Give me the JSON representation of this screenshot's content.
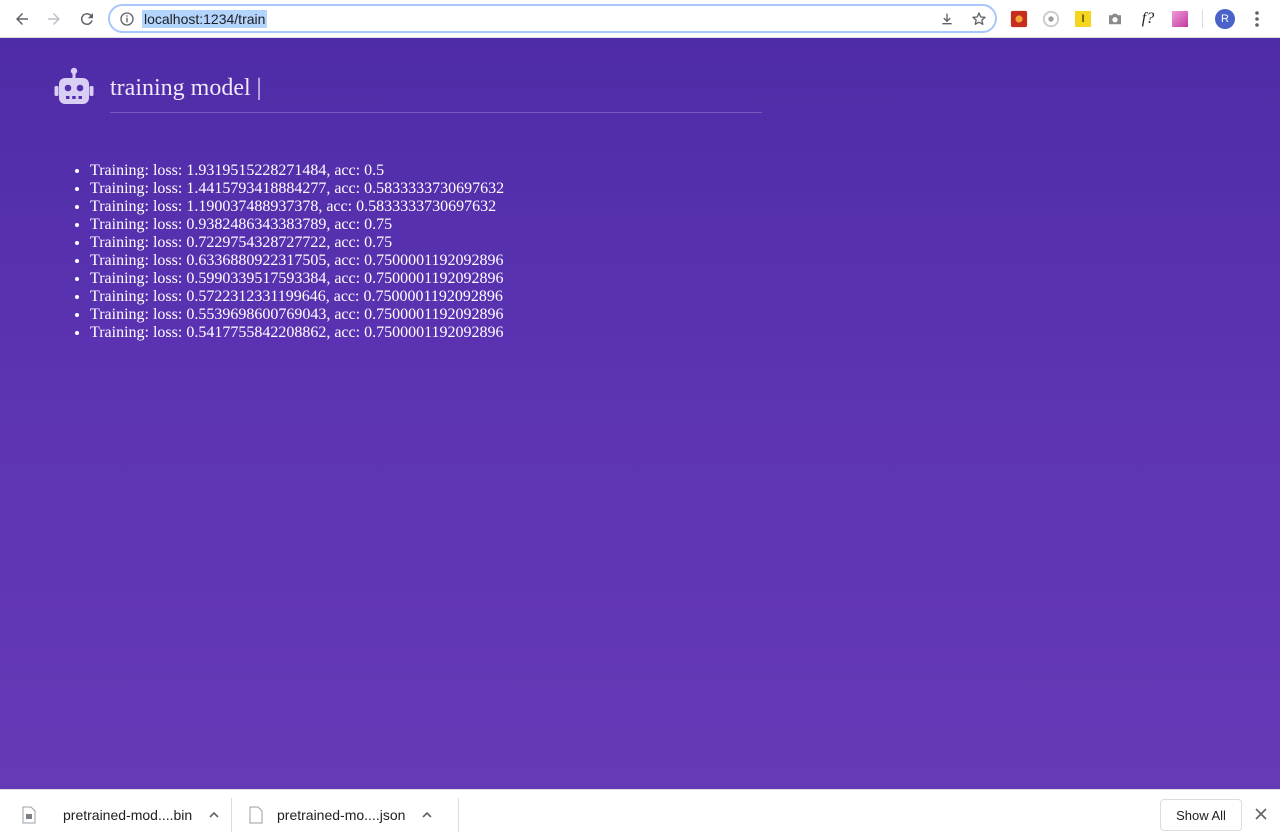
{
  "browser": {
    "url": "localhost:1234/train",
    "profile_initial": "R",
    "extensions": [
      "ext-red-icon",
      "ext-circle-icon",
      "ext-yellow-icon",
      "camera-icon",
      "font-f-icon",
      "gradient-icon"
    ],
    "font_ext_label": "f?",
    "yellow_ext_label": "I"
  },
  "page": {
    "title": "training model |",
    "log": [
      "Training: loss: 1.9319515228271484, acc: 0.5",
      "Training: loss: 1.4415793418884277, acc: 0.5833333730697632",
      "Training: loss: 1.190037488937378, acc: 0.5833333730697632",
      "Training: loss: 0.9382486343383789, acc: 0.75",
      "Training: loss: 0.7229754328727722, acc: 0.75",
      "Training: loss: 0.6336880922317505, acc: 0.7500001192092896",
      "Training: loss: 0.5990339517593384, acc: 0.7500001192092896",
      "Training: loss: 0.5722312331199646, acc: 0.7500001192092896",
      "Training: loss: 0.5539698600769043, acc: 0.7500001192092896",
      "Training: loss: 0.5417755842208862, acc: 0.7500001192092896"
    ]
  },
  "downloads": {
    "items": [
      {
        "name": "pretrained-mod....bin"
      },
      {
        "name": "pretrained-mo....json"
      }
    ],
    "show_all_label": "Show All"
  },
  "colors": {
    "page_bg_top": "#4f2ca7",
    "page_bg_bottom": "#6639b6",
    "robot_icon": "#d9cff5"
  }
}
